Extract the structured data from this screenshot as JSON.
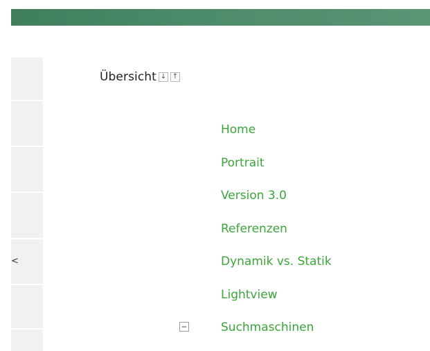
{
  "header": {
    "bar_color": "#4b8a68"
  },
  "left_rail": {
    "glyph": "<"
  },
  "overview": {
    "title": "Übersicht",
    "sort_down": "↓",
    "sort_up": "↑"
  },
  "nav": {
    "link_color": "#3aa63a",
    "items": [
      {
        "label": "Home"
      },
      {
        "label": "Portrait"
      },
      {
        "label": "Version 3.0"
      },
      {
        "label": "Referenzen"
      },
      {
        "label": "Dynamik vs. Statik"
      },
      {
        "label": "Lightview"
      },
      {
        "label": "Suchmaschinen",
        "toggle": "−"
      }
    ]
  }
}
